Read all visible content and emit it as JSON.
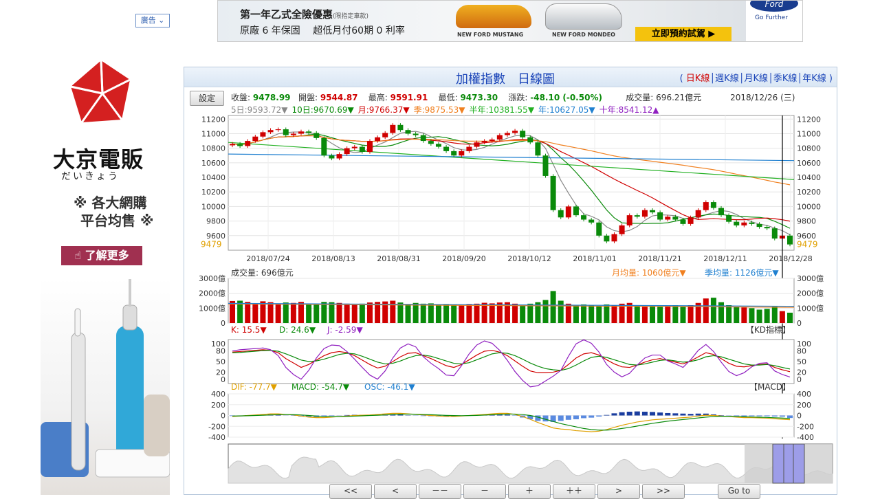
{
  "ad_tag": "廣告",
  "top_banner": {
    "line1": "第一年乙式全險優惠",
    "line1_note": "(限指定車款)",
    "line2": "原廠 6 年保固　 超低月付60期 0 利率",
    "car1_caption": "NEW FORD MUSTANG",
    "car2_caption": "NEW FORD MONDEO",
    "cta": "立即預約試駕",
    "ford_logo": "Ford",
    "ford_tagline": "Go Further"
  },
  "side_ad": {
    "brand": "大京電販",
    "kana": "だいきょう",
    "slogan_line1": "各大網購",
    "slogan_line2": "平台均售",
    "cta": "了解更多",
    "cta_icon": "hand-pointer-icon"
  },
  "chart_panel": {
    "title": "加權指數　日線圖",
    "period_links": [
      "日K線",
      "週K線",
      "月K線",
      "季K線",
      "年K線"
    ],
    "active_period": "日K線",
    "settings_label": "設定",
    "quote": {
      "close_label": "收盤:",
      "close": "9478.99",
      "open_label": "開盤:",
      "open": "9544.87",
      "high_label": "最高:",
      "high": "9591.91",
      "low_label": "最低:",
      "low": "9473.30",
      "change_label": "漲跌:",
      "change": "-48.10 (-0.50%)",
      "volume_label": "成交量:",
      "volume": "696.21億元",
      "date": "2018/12/26 (三)"
    },
    "ma_line": [
      {
        "label": "5日:",
        "value": "9593.72▼",
        "color": "#888888"
      },
      {
        "label": "10日:",
        "value": "9670.69▼",
        "color": "#0a8a0a"
      },
      {
        "label": "月:",
        "value": "9766.37▼",
        "color": "#d00000"
      },
      {
        "label": "季:",
        "value": "9875.53▼",
        "color": "#f08020"
      },
      {
        "label": "半年:",
        "value": "10381.55▼",
        "color": "#22b022"
      },
      {
        "label": "年:",
        "value": "10627.05▼",
        "color": "#2080d0"
      },
      {
        "label": "十年:",
        "value": "8541.12▲",
        "color": "#9020c0"
      }
    ],
    "volume_header": "成交量: 696億元",
    "volume_ma_month": "月均量: 1060億元▼",
    "volume_ma_season": "季均量: 1126億元▼",
    "kd": {
      "k": "K: 15.5▼",
      "d": "D: 24.6▼",
      "j": "J: -2.59▼",
      "tag": "【KD指標】"
    },
    "macd": {
      "dif": "DIF: -77.7▼",
      "macd": "MACD: -54.7▼",
      "osc": "OSC: -46.1▼",
      "tag": "【MACD】"
    },
    "nav_buttons": [
      "<<",
      "<",
      "－－",
      "－",
      "＋",
      "＋＋",
      ">",
      ">>",
      "Go to"
    ]
  },
  "chart_data": [
    {
      "type": "candlestick",
      "title": "加權指數 日線圖",
      "x_ticks": [
        "2018/07/24",
        "2018/08/13",
        "2018/08/31",
        "2018/09/20",
        "2018/10/12",
        "2018/11/01",
        "2018/11/21",
        "2018/12/11",
        "2018/12/28"
      ],
      "y_ticks": [
        11200,
        11000,
        10800,
        10600,
        10400,
        10200,
        10000,
        9800,
        9600
      ],
      "ylim": [
        9400,
        11250
      ],
      "last_close_marker": "9479",
      "close_series": [
        10860,
        10830,
        10900,
        10960,
        11020,
        11050,
        11060,
        10980,
        11000,
        11030,
        11010,
        10940,
        10700,
        10660,
        10720,
        10800,
        10820,
        10750,
        10900,
        10950,
        11010,
        11120,
        11050,
        11000,
        10980,
        10900,
        10860,
        10820,
        10760,
        10700,
        10760,
        10820,
        10880,
        10900,
        10920,
        10980,
        11010,
        11040,
        10950,
        10880,
        10700,
        10420,
        9950,
        9850,
        10000,
        9880,
        9820,
        9780,
        9600,
        9520,
        9620,
        9740,
        9880,
        9860,
        9950,
        9920,
        9820,
        9860,
        9820,
        9760,
        9850,
        9950,
        10060,
        9980,
        9880,
        9790,
        9740,
        9780,
        9760,
        9720,
        9700,
        9560,
        9600,
        9479
      ],
      "moving_averages": [
        {
          "name": "5日",
          "color": "#888888"
        },
        {
          "name": "10日",
          "color": "#0a8a0a"
        },
        {
          "name": "月",
          "color": "#d00000"
        },
        {
          "name": "季",
          "color": "#f08020"
        },
        {
          "name": "半年",
          "color": "#22b022"
        },
        {
          "name": "年",
          "color": "#2080d0"
        }
      ]
    },
    {
      "type": "bar",
      "title": "成交量",
      "y_ticks": [
        "3000億",
        "2000億",
        "1000億",
        "0"
      ],
      "ylim": [
        0,
        3000
      ],
      "values": [
        1480,
        1500,
        1420,
        1300,
        1460,
        1400,
        1250,
        1380,
        1350,
        1420,
        1300,
        1280,
        1420,
        1400,
        1350,
        1300,
        1260,
        1300,
        1380,
        1420,
        1450,
        1500,
        1380,
        1280,
        1350,
        1300,
        1320,
        1250,
        1280,
        1240,
        1200,
        1280,
        1300,
        1360,
        1320,
        1380,
        1400,
        1300,
        1200,
        1300,
        1400,
        1550,
        2150,
        1500,
        1300,
        1200,
        1250,
        1180,
        1150,
        1250,
        1200,
        1300,
        1350,
        1200,
        1100,
        1150,
        1100,
        1150,
        1200,
        1100,
        1200,
        1350,
        1650,
        1700,
        1400,
        1200,
        1100,
        1050,
        1000,
        900,
        950,
        1150,
        800,
        696
      ]
    },
    {
      "type": "line",
      "title": "KD指標",
      "y_ticks": [
        100,
        80,
        50,
        20,
        0
      ],
      "ylim": [
        0,
        100
      ],
      "series": [
        {
          "name": "K",
          "values": [
            82,
            84,
            86,
            88,
            90,
            88,
            80,
            60,
            45,
            30,
            40,
            55,
            70,
            80,
            84,
            80,
            70,
            55,
            40,
            28,
            34,
            50,
            66,
            78,
            80,
            70,
            60,
            48,
            36,
            30,
            40,
            56,
            72,
            85,
            88,
            82,
            70,
            52,
            34,
            18,
            12,
            12,
            14,
            20,
            40,
            62,
            76,
            80,
            72,
            56,
            42,
            32,
            30,
            38,
            48,
            56,
            60,
            54,
            48,
            42,
            52,
            66,
            80,
            74,
            60,
            44,
            34,
            32,
            36,
            40,
            42,
            30,
            22,
            15.5
          ],
          "color": "#d00000"
        },
        {
          "name": "D",
          "values": [
            80,
            81,
            83,
            85,
            87,
            88,
            85,
            76,
            66,
            55,
            50,
            52,
            58,
            66,
            74,
            78,
            76,
            68,
            58,
            48,
            42,
            44,
            52,
            62,
            70,
            72,
            68,
            60,
            52,
            44,
            42,
            46,
            56,
            66,
            76,
            80,
            78,
            70,
            58,
            45,
            34,
            26,
            22,
            20,
            26,
            38,
            52,
            64,
            68,
            64,
            56,
            48,
            40,
            38,
            42,
            48,
            54,
            56,
            52,
            48,
            50,
            56,
            66,
            70,
            66,
            58,
            50,
            42,
            38,
            38,
            40,
            36,
            30,
            24.6
          ],
          "color": "#0a8a0a"
        },
        {
          "name": "J",
          "values": [
            86,
            90,
            92,
            94,
            96,
            90,
            70,
            30,
            6,
            -10,
            20,
            62,
            94,
            106,
            104,
            84,
            58,
            30,
            4,
            -10,
            18,
            62,
            96,
            110,
            100,
            66,
            44,
            26,
            4,
            2,
            36,
            76,
            106,
            120,
            112,
            88,
            54,
            16,
            -14,
            -36,
            -32,
            -16,
            0,
            20,
            68,
            110,
            124,
            112,
            82,
            40,
            14,
            -2,
            10,
            38,
            62,
            72,
            72,
            52,
            42,
            30,
            56,
            88,
            108,
            84,
            48,
            16,
            2,
            12,
            32,
            44,
            46,
            18,
            6,
            -2.59
          ],
          "color": "#9020c0"
        }
      ]
    },
    {
      "type": "bar",
      "title": "MACD",
      "y_ticks": [
        400,
        200,
        0,
        -200,
        -400
      ],
      "ylim": [
        -400,
        400
      ],
      "series": [
        {
          "name": "DIF",
          "values": [
            -20,
            -10,
            0,
            10,
            20,
            30,
            30,
            20,
            10,
            -10,
            -30,
            -40,
            -40,
            -30,
            -20,
            -10,
            0,
            5,
            10,
            20,
            30,
            40,
            40,
            30,
            20,
            10,
            0,
            -10,
            -20,
            -20,
            -10,
            0,
            10,
            20,
            30,
            40,
            40,
            20,
            -20,
            -70,
            -130,
            -180,
            -230,
            -250,
            -260,
            -280,
            -290,
            -300,
            -290,
            -260,
            -220,
            -180,
            -150,
            -120,
            -100,
            -80,
            -70,
            -60,
            -50,
            -40,
            -30,
            -10,
            5,
            0,
            -10,
            -20,
            -30,
            -40,
            -40,
            -45,
            -50,
            -60,
            -70,
            -77.7
          ],
          "color": "#e0a000"
        },
        {
          "name": "MACD",
          "values": [
            -10,
            -8,
            -5,
            0,
            5,
            10,
            15,
            18,
            16,
            10,
            0,
            -10,
            -18,
            -22,
            -22,
            -18,
            -12,
            -6,
            0,
            5,
            10,
            18,
            24,
            26,
            24,
            20,
            14,
            8,
            2,
            -2,
            -4,
            -2,
            2,
            8,
            14,
            20,
            26,
            26,
            18,
            0,
            -30,
            -70,
            -110,
            -150,
            -180,
            -210,
            -240,
            -260,
            -270,
            -270,
            -260,
            -240,
            -220,
            -195,
            -170,
            -145,
            -125,
            -105,
            -90,
            -75,
            -60,
            -45,
            -30,
            -20,
            -16,
            -16,
            -20,
            -24,
            -28,
            -32,
            -36,
            -42,
            -48,
            -54.7
          ],
          "color": "#0a8a0a"
        },
        {
          "name": "OSC",
          "values": [
            -10,
            -2,
            5,
            10,
            15,
            20,
            15,
            2,
            -6,
            -20,
            -30,
            -30,
            -22,
            -8,
            2,
            8,
            12,
            11,
            10,
            15,
            20,
            22,
            16,
            4,
            -4,
            -10,
            -14,
            -18,
            -22,
            -18,
            -6,
            2,
            8,
            12,
            16,
            20,
            14,
            -6,
            -38,
            -70,
            -100,
            -110,
            -120,
            -100,
            -80,
            -70,
            -50,
            -40,
            -20,
            10,
            40,
            60,
            70,
            75,
            70,
            65,
            55,
            45,
            40,
            35,
            30,
            35,
            35,
            20,
            6,
            -4,
            -10,
            -16,
            -12,
            -13,
            -14,
            -18,
            -22,
            -46.1
          ],
          "color": "#2040c0"
        }
      ]
    }
  ]
}
